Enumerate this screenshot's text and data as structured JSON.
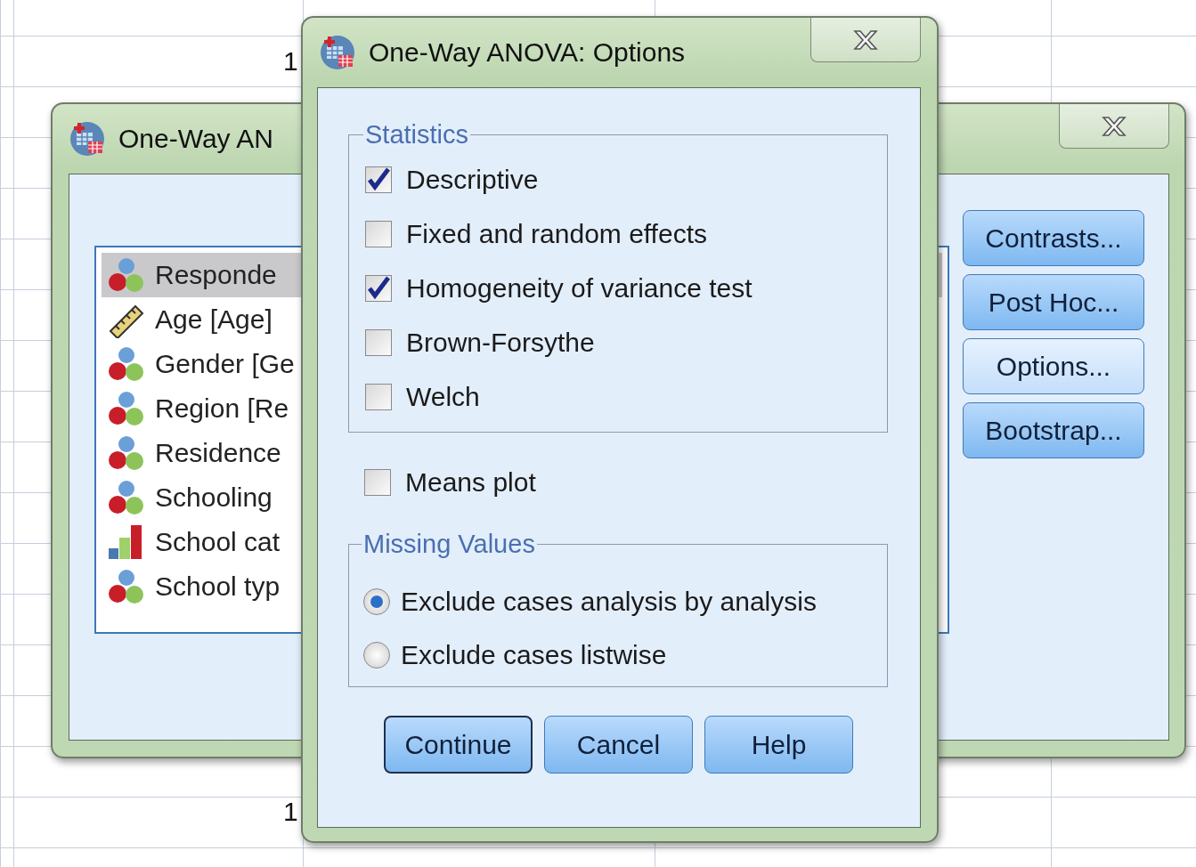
{
  "sheet": {
    "cells": [
      {
        "text": "1"
      },
      {
        "text": "1"
      }
    ]
  },
  "main_dialog": {
    "title": "One-Way AN",
    "variables": [
      {
        "name": "Responde",
        "kind": "nominal",
        "selected": true
      },
      {
        "name": "Age [Age]",
        "kind": "scale",
        "selected": false
      },
      {
        "name": "Gender [Ge",
        "kind": "nominal",
        "selected": false
      },
      {
        "name": "Region [Re",
        "kind": "nominal",
        "selected": false
      },
      {
        "name": "Residence",
        "kind": "nominal",
        "selected": false
      },
      {
        "name": "Schooling",
        "kind": "nominal",
        "selected": false
      },
      {
        "name": "School cat",
        "kind": "ordinal",
        "selected": false
      },
      {
        "name": "School typ",
        "kind": "nominal",
        "selected": false
      }
    ],
    "buttons": [
      {
        "label": "Contrasts...",
        "focused": false
      },
      {
        "label": "Post Hoc...",
        "focused": false
      },
      {
        "label": "Options...",
        "focused": true
      },
      {
        "label": "Bootstrap...",
        "focused": false
      }
    ]
  },
  "options_dialog": {
    "title": "One-Way ANOVA: Options",
    "statistics": {
      "title": "Statistics",
      "items": [
        {
          "label": "Descriptive",
          "checked": true
        },
        {
          "label": "Fixed and random effects",
          "checked": false
        },
        {
          "label": "Homogeneity of variance test",
          "checked": true
        },
        {
          "label": "Brown-Forsythe",
          "checked": false
        },
        {
          "label": "Welch",
          "checked": false
        }
      ]
    },
    "means_plot": {
      "label": "Means plot",
      "checked": false
    },
    "missing_values": {
      "title": "Missing Values",
      "options": [
        {
          "label": "Exclude cases analysis by analysis",
          "selected": true
        },
        {
          "label": "Exclude cases listwise",
          "selected": false
        }
      ]
    },
    "buttons": [
      {
        "label": "Continue",
        "default": true
      },
      {
        "label": "Cancel",
        "default": false
      },
      {
        "label": "Help",
        "default": false
      }
    ]
  }
}
